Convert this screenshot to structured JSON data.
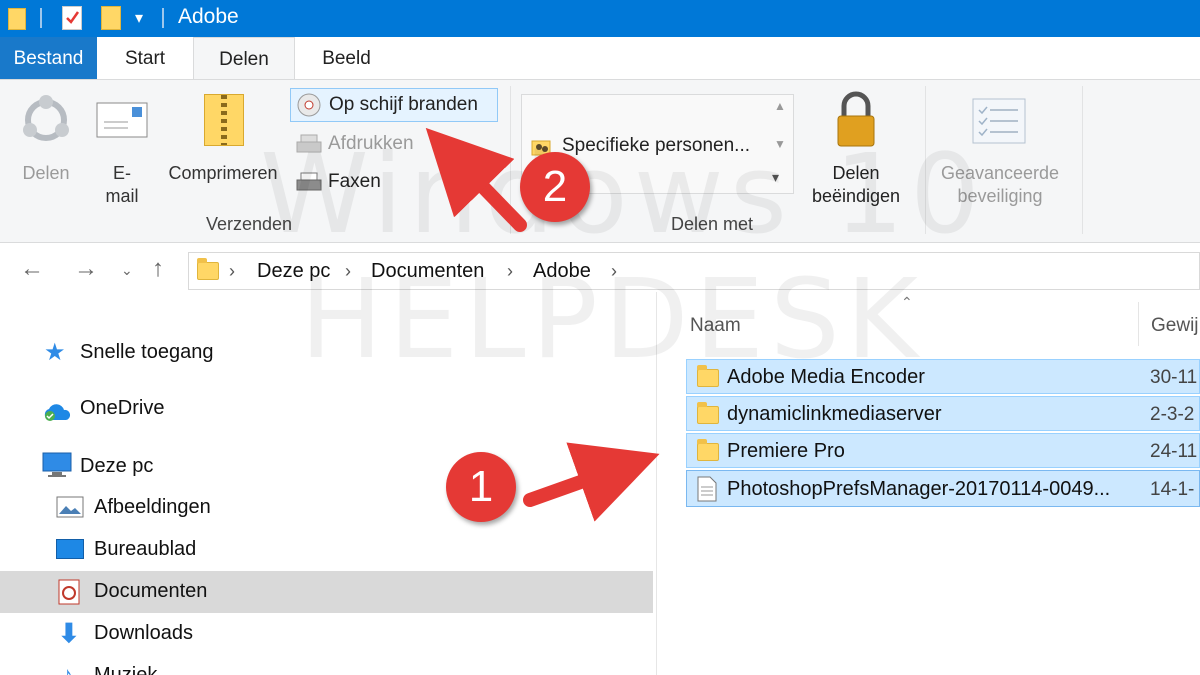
{
  "window": {
    "title": "Adobe"
  },
  "tabs": [
    {
      "label": "Bestand"
    },
    {
      "label": "Start"
    },
    {
      "label": "Delen"
    },
    {
      "label": "Beeld"
    }
  ],
  "ribbon": {
    "share": "Delen",
    "email": "E-\nmail",
    "compress": "Comprimeren",
    "burn": "Op schijf branden",
    "print": "Afdrukken",
    "fax": "Faxen",
    "group_send": "Verzenden",
    "specific_people": "Specifieke personen...",
    "group_share_with": "Delen met",
    "stop_sharing": "Delen\nbeëindigen",
    "advanced_security": "Geavanceerde\nbeveiliging"
  },
  "address": {
    "crumbs": [
      "Deze pc",
      "Documenten",
      "Adobe"
    ]
  },
  "navpane": {
    "quick_access": "Snelle toegang",
    "onedrive": "OneDrive",
    "this_pc": "Deze pc",
    "pictures": "Afbeeldingen",
    "desktop": "Bureaublad",
    "documents": "Documenten",
    "downloads": "Downloads",
    "music": "Muziek"
  },
  "list": {
    "col_name": "Naam",
    "col_modified": "Gewij",
    "files": [
      {
        "name": "Adobe Media Encoder",
        "date": "30-11",
        "type": "folder"
      },
      {
        "name": "dynamiclinkmediaserver",
        "date": "2-3-2",
        "type": "folder"
      },
      {
        "name": "Premiere Pro",
        "date": "24-11",
        "type": "folder"
      },
      {
        "name": "PhotoshopPrefsManager-20170114-0049...",
        "date": "14-1-",
        "type": "file"
      }
    ]
  },
  "annotations": {
    "one": "1",
    "two": "2"
  },
  "watermark": {
    "line1": "Windows 10",
    "line2": "HELPDESK"
  },
  "colors": {
    "titlebar": "#0078d7",
    "selection": "#cce8ff",
    "badge": "#e53935"
  }
}
